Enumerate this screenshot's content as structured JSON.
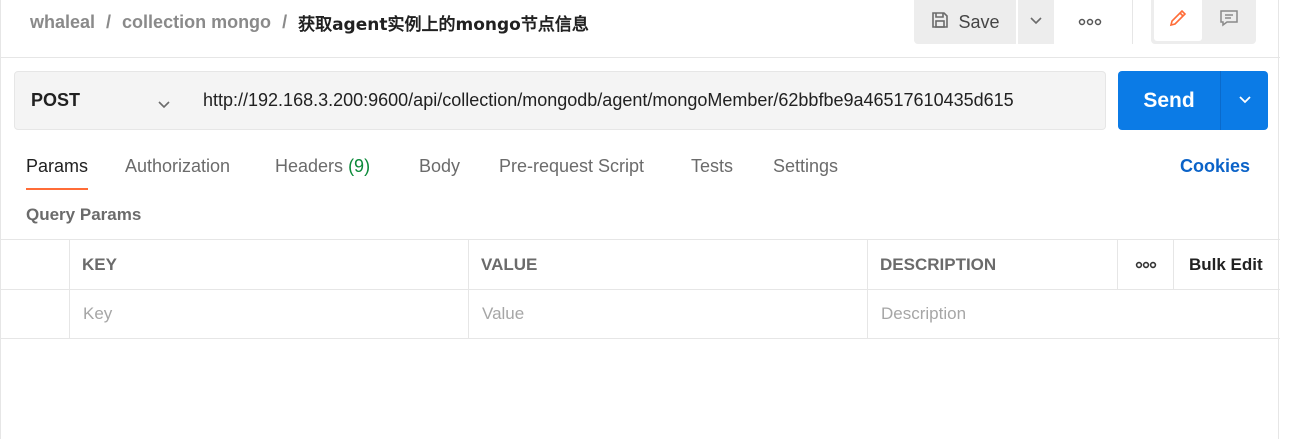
{
  "breadcrumb": {
    "workspace": "whaleal",
    "collection": "collection mongo",
    "separator": "/",
    "request": "获取agent实例上的mongo节点信息"
  },
  "header": {
    "save_label": "Save",
    "icons": [
      "save-icon",
      "chevron-down-icon",
      "more-horizontal-icon",
      "pencil-icon",
      "comment-icon"
    ]
  },
  "request": {
    "method": "POST",
    "url": "http://192.168.3.200:9600/api/collection/mongodb/agent/mongoMember/62bbfbe9a46517610435d615",
    "send_label": "Send"
  },
  "tabs": [
    {
      "label": "Params",
      "count": "",
      "active": true
    },
    {
      "label": "Authorization",
      "count": "",
      "active": false
    },
    {
      "label": "Headers",
      "count": "(9)",
      "active": false
    },
    {
      "label": "Body",
      "count": "",
      "active": false
    },
    {
      "label": "Pre-request Script",
      "count": "",
      "active": false
    },
    {
      "label": "Tests",
      "count": "",
      "active": false
    },
    {
      "label": "Settings",
      "count": "",
      "active": false
    }
  ],
  "cookies_label": "Cookies",
  "query_params": {
    "title": "Query Params",
    "columns": {
      "key": "KEY",
      "value": "VALUE",
      "description": "DESCRIPTION"
    },
    "bulk_edit_label": "Bulk Edit",
    "placeholders": {
      "key": "Key",
      "value": "Value",
      "description": "Description"
    }
  },
  "colors": {
    "accent": "#ff6c37",
    "send": "#0b7be6",
    "link": "#0b63c8",
    "count": "#0c8a3a"
  }
}
